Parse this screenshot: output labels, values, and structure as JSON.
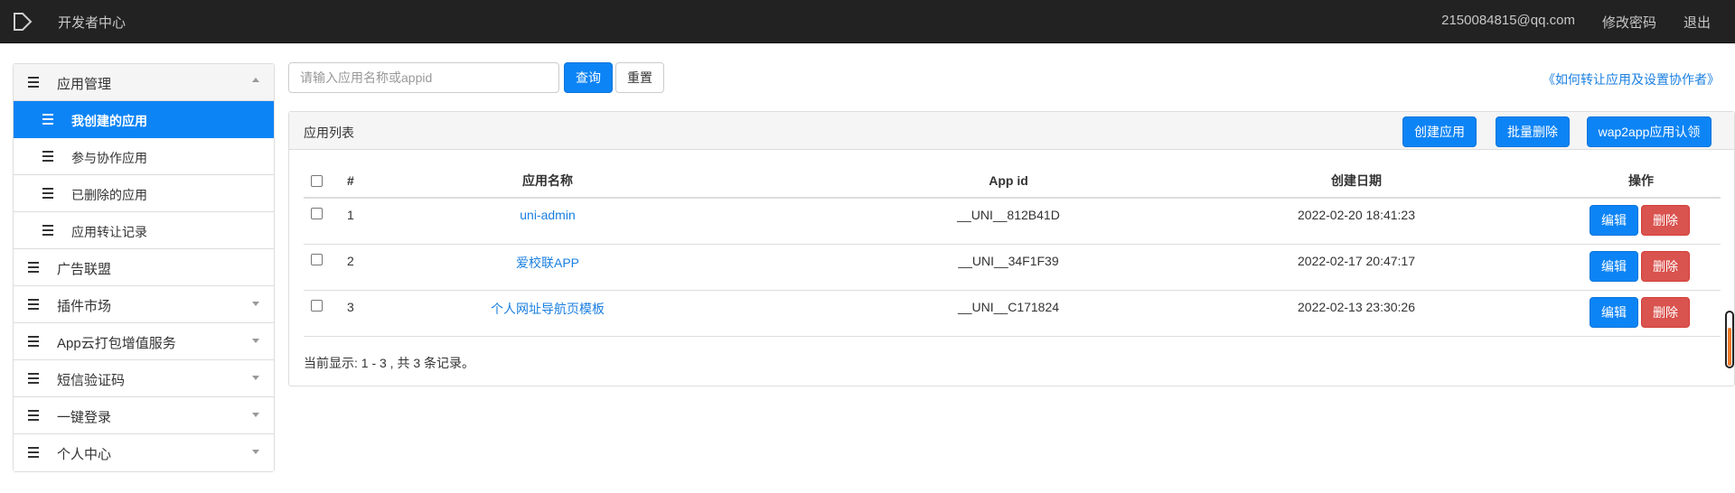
{
  "topbar": {
    "brand": "开发者中心",
    "email": "2150084815@qq.com",
    "change_password": "修改密码",
    "logout": "退出"
  },
  "sidebar": {
    "groups": [
      {
        "label": "应用管理",
        "expanded": true,
        "items": [
          {
            "label": "我创建的应用",
            "active": true
          },
          {
            "label": "参与协作应用"
          },
          {
            "label": "已删除的应用"
          },
          {
            "label": "应用转让记录"
          }
        ]
      },
      {
        "label": "广告联盟"
      },
      {
        "label": "插件市场"
      },
      {
        "label": "App云打包增值服务"
      },
      {
        "label": "短信验证码"
      },
      {
        "label": "一键登录"
      },
      {
        "label": "个人中心"
      }
    ]
  },
  "search": {
    "placeholder": "请输入应用名称或appid",
    "query_button": "查询",
    "reset_button": "重置"
  },
  "help_link": "《如何转让应用及设置协作者》",
  "panel": {
    "title": "应用列表",
    "create_button": "创建应用",
    "batch_delete_button": "批量删除",
    "wap2app_button": "wap2app应用认领"
  },
  "table": {
    "headers": {
      "num": "#",
      "name": "应用名称",
      "appid": "App id",
      "date": "创建日期",
      "ops": "操作"
    },
    "rows": [
      {
        "num": "1",
        "name": "uni-admin",
        "appid": "__UNI__812B41D",
        "date": "2022-02-20 18:41:23"
      },
      {
        "num": "2",
        "name": "爱校联APP",
        "appid": "__UNI__34F1F39",
        "date": "2022-02-17 20:47:17"
      },
      {
        "num": "3",
        "name": "个人网址导航页模板",
        "appid": "__UNI__C171824",
        "date": "2022-02-13 23:30:26"
      }
    ],
    "edit_label": "编辑",
    "delete_label": "删除"
  },
  "records_text": "当前显示: 1 - 3 , 共 3 条记录。",
  "colors": {
    "primary": "#0d84f5",
    "danger": "#d9534f",
    "topbar": "#222222",
    "link": "#1a7fe0"
  }
}
